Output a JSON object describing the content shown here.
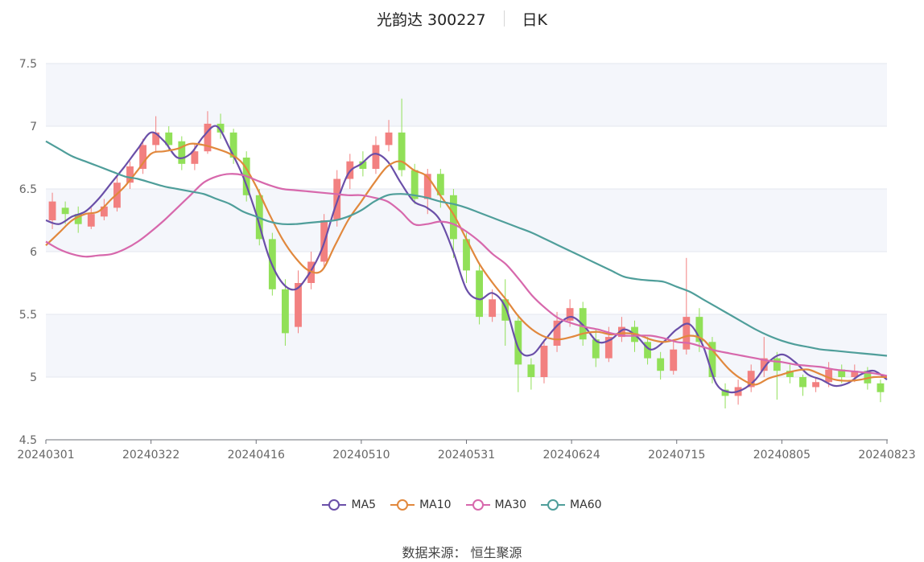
{
  "header": {
    "title": "光韵达 300227",
    "tab_label": "日K"
  },
  "chart_data": {
    "type": "candlestick",
    "title": "光韵达 300227",
    "period": "日K",
    "ylim": [
      4.5,
      7.5
    ],
    "yticks": [
      "7.5",
      "7",
      "6.5",
      "6",
      "5.5",
      "5",
      "4.5"
    ],
    "xticks": [
      "20240301",
      "20240322",
      "20240416",
      "20240510",
      "20240531",
      "20240624",
      "20240715",
      "20240805",
      "20240823"
    ],
    "grid": true,
    "grid_band_colors": [
      "#f4f6fb",
      "#ffffff"
    ],
    "legend_position": "bottom-center",
    "colors": {
      "up": "#f28080",
      "down": "#91e058"
    },
    "series": [
      {
        "name": "MA5",
        "color": "#6a4fa8",
        "values": [
          6.25,
          6.22,
          6.28,
          6.32,
          6.42,
          6.55,
          6.68,
          6.82,
          6.95,
          6.88,
          6.75,
          6.78,
          6.92,
          7.0,
          6.82,
          6.6,
          6.3,
          5.95,
          5.75,
          5.7,
          5.82,
          6.02,
          6.35,
          6.62,
          6.7,
          6.78,
          6.72,
          6.55,
          6.4,
          6.35,
          6.25,
          6.0,
          5.7,
          5.62,
          5.67,
          5.55,
          5.22,
          5.18,
          5.3,
          5.42,
          5.48,
          5.4,
          5.28,
          5.3,
          5.38,
          5.32,
          5.22,
          5.28,
          5.38,
          5.42,
          5.25,
          4.95,
          4.88,
          4.9,
          4.98,
          5.12,
          5.18,
          5.12,
          5.02,
          4.98,
          4.93,
          4.95,
          5.02,
          5.05,
          4.98
        ]
      },
      {
        "name": "MA10",
        "color": "#e1883d",
        "values": [
          6.05,
          6.15,
          6.25,
          6.3,
          6.32,
          6.42,
          6.52,
          6.65,
          6.78,
          6.8,
          6.82,
          6.86,
          6.85,
          6.82,
          6.78,
          6.7,
          6.52,
          6.3,
          6.1,
          5.95,
          5.85,
          5.85,
          6.05,
          6.25,
          6.4,
          6.55,
          6.68,
          6.72,
          6.65,
          6.6,
          6.45,
          6.3,
          6.1,
          5.9,
          5.75,
          5.62,
          5.48,
          5.38,
          5.32,
          5.3,
          5.32,
          5.35,
          5.36,
          5.34,
          5.35,
          5.34,
          5.3,
          5.28,
          5.3,
          5.33,
          5.3,
          5.18,
          5.06,
          4.98,
          4.94,
          4.99,
          5.02,
          5.05,
          5.06,
          5.02,
          4.98,
          4.97,
          4.98,
          5.0,
          5.0
        ]
      },
      {
        "name": "MA30",
        "color": "#d768ac",
        "values": [
          6.08,
          6.02,
          5.98,
          5.96,
          5.97,
          5.98,
          6.02,
          6.08,
          6.16,
          6.25,
          6.35,
          6.45,
          6.55,
          6.6,
          6.62,
          6.61,
          6.57,
          6.53,
          6.5,
          6.49,
          6.48,
          6.47,
          6.46,
          6.45,
          6.45,
          6.43,
          6.4,
          6.32,
          6.22,
          6.22,
          6.24,
          6.22,
          6.16,
          6.08,
          5.98,
          5.9,
          5.78,
          5.65,
          5.55,
          5.47,
          5.43,
          5.4,
          5.38,
          5.35,
          5.33,
          5.33,
          5.33,
          5.31,
          5.28,
          5.27,
          5.24,
          5.21,
          5.19,
          5.17,
          5.15,
          5.13,
          5.12,
          5.1,
          5.09,
          5.08,
          5.06,
          5.05,
          5.04,
          5.03,
          5.01
        ]
      },
      {
        "name": "MA60",
        "color": "#4f9e9a",
        "values": [
          6.88,
          6.82,
          6.76,
          6.72,
          6.68,
          6.64,
          6.6,
          6.58,
          6.55,
          6.52,
          6.5,
          6.48,
          6.46,
          6.42,
          6.38,
          6.32,
          6.28,
          6.24,
          6.22,
          6.22,
          6.23,
          6.24,
          6.25,
          6.28,
          6.33,
          6.4,
          6.45,
          6.46,
          6.45,
          6.43,
          6.4,
          6.38,
          6.35,
          6.31,
          6.27,
          6.23,
          6.19,
          6.15,
          6.1,
          6.05,
          6.0,
          5.95,
          5.9,
          5.85,
          5.8,
          5.78,
          5.77,
          5.76,
          5.72,
          5.68,
          5.62,
          5.56,
          5.5,
          5.44,
          5.38,
          5.33,
          5.29,
          5.26,
          5.24,
          5.22,
          5.21,
          5.2,
          5.19,
          5.18,
          5.17
        ]
      }
    ],
    "candles": [
      [
        6.25,
        6.4,
        6.47,
        6.18
      ],
      [
        6.35,
        6.3,
        6.4,
        6.22
      ],
      [
        6.3,
        6.22,
        6.36,
        6.15
      ],
      [
        6.2,
        6.3,
        6.35,
        6.18
      ],
      [
        6.28,
        6.36,
        6.42,
        6.25
      ],
      [
        6.35,
        6.55,
        6.6,
        6.32
      ],
      [
        6.55,
        6.68,
        6.72,
        6.5
      ],
      [
        6.66,
        6.85,
        6.9,
        6.62
      ],
      [
        6.85,
        6.95,
        7.08,
        6.8
      ],
      [
        6.95,
        6.85,
        7.0,
        6.8
      ],
      [
        6.88,
        6.7,
        6.92,
        6.65
      ],
      [
        6.7,
        6.8,
        6.86,
        6.65
      ],
      [
        6.8,
        7.02,
        7.12,
        6.78
      ],
      [
        7.02,
        6.95,
        7.1,
        6.9
      ],
      [
        6.95,
        6.75,
        6.98,
        6.7
      ],
      [
        6.75,
        6.45,
        6.8,
        6.4
      ],
      [
        6.45,
        6.1,
        6.5,
        6.05
      ],
      [
        6.1,
        5.7,
        6.15,
        5.65
      ],
      [
        5.7,
        5.35,
        5.78,
        5.25
      ],
      [
        5.4,
        5.75,
        5.85,
        5.35
      ],
      [
        5.75,
        5.92,
        6.0,
        5.7
      ],
      [
        5.92,
        6.25,
        6.3,
        5.88
      ],
      [
        6.25,
        6.58,
        6.65,
        6.2
      ],
      [
        6.58,
        6.72,
        6.78,
        6.5
      ],
      [
        6.72,
        6.66,
        6.8,
        6.6
      ],
      [
        6.66,
        6.85,
        6.92,
        6.62
      ],
      [
        6.85,
        6.95,
        7.05,
        6.8
      ],
      [
        6.95,
        6.65,
        7.22,
        6.6
      ],
      [
        6.65,
        6.42,
        6.7,
        6.38
      ],
      [
        6.42,
        6.62,
        6.66,
        6.3
      ],
      [
        6.62,
        6.45,
        6.66,
        6.35
      ],
      [
        6.45,
        6.1,
        6.5,
        5.95
      ],
      [
        6.1,
        5.85,
        6.15,
        5.75
      ],
      [
        5.85,
        5.48,
        5.9,
        5.42
      ],
      [
        5.48,
        5.62,
        5.7,
        5.44
      ],
      [
        5.62,
        5.45,
        5.78,
        5.25
      ],
      [
        5.45,
        5.1,
        5.5,
        4.88
      ],
      [
        5.1,
        5.0,
        5.15,
        4.9
      ],
      [
        5.0,
        5.25,
        5.3,
        4.95
      ],
      [
        5.25,
        5.45,
        5.52,
        5.2
      ],
      [
        5.45,
        5.55,
        5.62,
        5.4
      ],
      [
        5.55,
        5.3,
        5.6,
        5.25
      ],
      [
        5.3,
        5.15,
        5.38,
        5.08
      ],
      [
        5.15,
        5.32,
        5.4,
        5.12
      ],
      [
        5.32,
        5.4,
        5.48,
        5.28
      ],
      [
        5.4,
        5.28,
        5.45,
        5.2
      ],
      [
        5.28,
        5.15,
        5.32,
        5.1
      ],
      [
        5.15,
        5.05,
        5.2,
        4.98
      ],
      [
        5.05,
        5.22,
        5.3,
        5.02
      ],
      [
        5.22,
        5.48,
        5.95,
        5.18
      ],
      [
        5.48,
        5.28,
        5.55,
        5.2
      ],
      [
        5.28,
        5.0,
        5.32,
        4.95
      ],
      [
        4.9,
        4.85,
        4.95,
        4.75
      ],
      [
        4.85,
        4.92,
        4.98,
        4.78
      ],
      [
        4.92,
        5.05,
        5.1,
        4.88
      ],
      [
        5.05,
        5.15,
        5.32,
        5.0
      ],
      [
        5.15,
        5.05,
        5.2,
        4.82
      ],
      [
        5.05,
        5.0,
        5.1,
        4.95
      ],
      [
        5.0,
        4.92,
        5.02,
        4.85
      ],
      [
        4.92,
        4.96,
        5.0,
        4.88
      ],
      [
        4.96,
        5.06,
        5.12,
        4.92
      ],
      [
        5.06,
        5.0,
        5.1,
        4.95
      ],
      [
        5.0,
        5.05,
        5.1,
        4.96
      ],
      [
        5.05,
        4.95,
        5.08,
        4.9
      ],
      [
        4.95,
        4.88,
        4.98,
        4.8
      ]
    ]
  },
  "footer": {
    "source_label": "数据来源：",
    "source_name": "恒生聚源"
  }
}
